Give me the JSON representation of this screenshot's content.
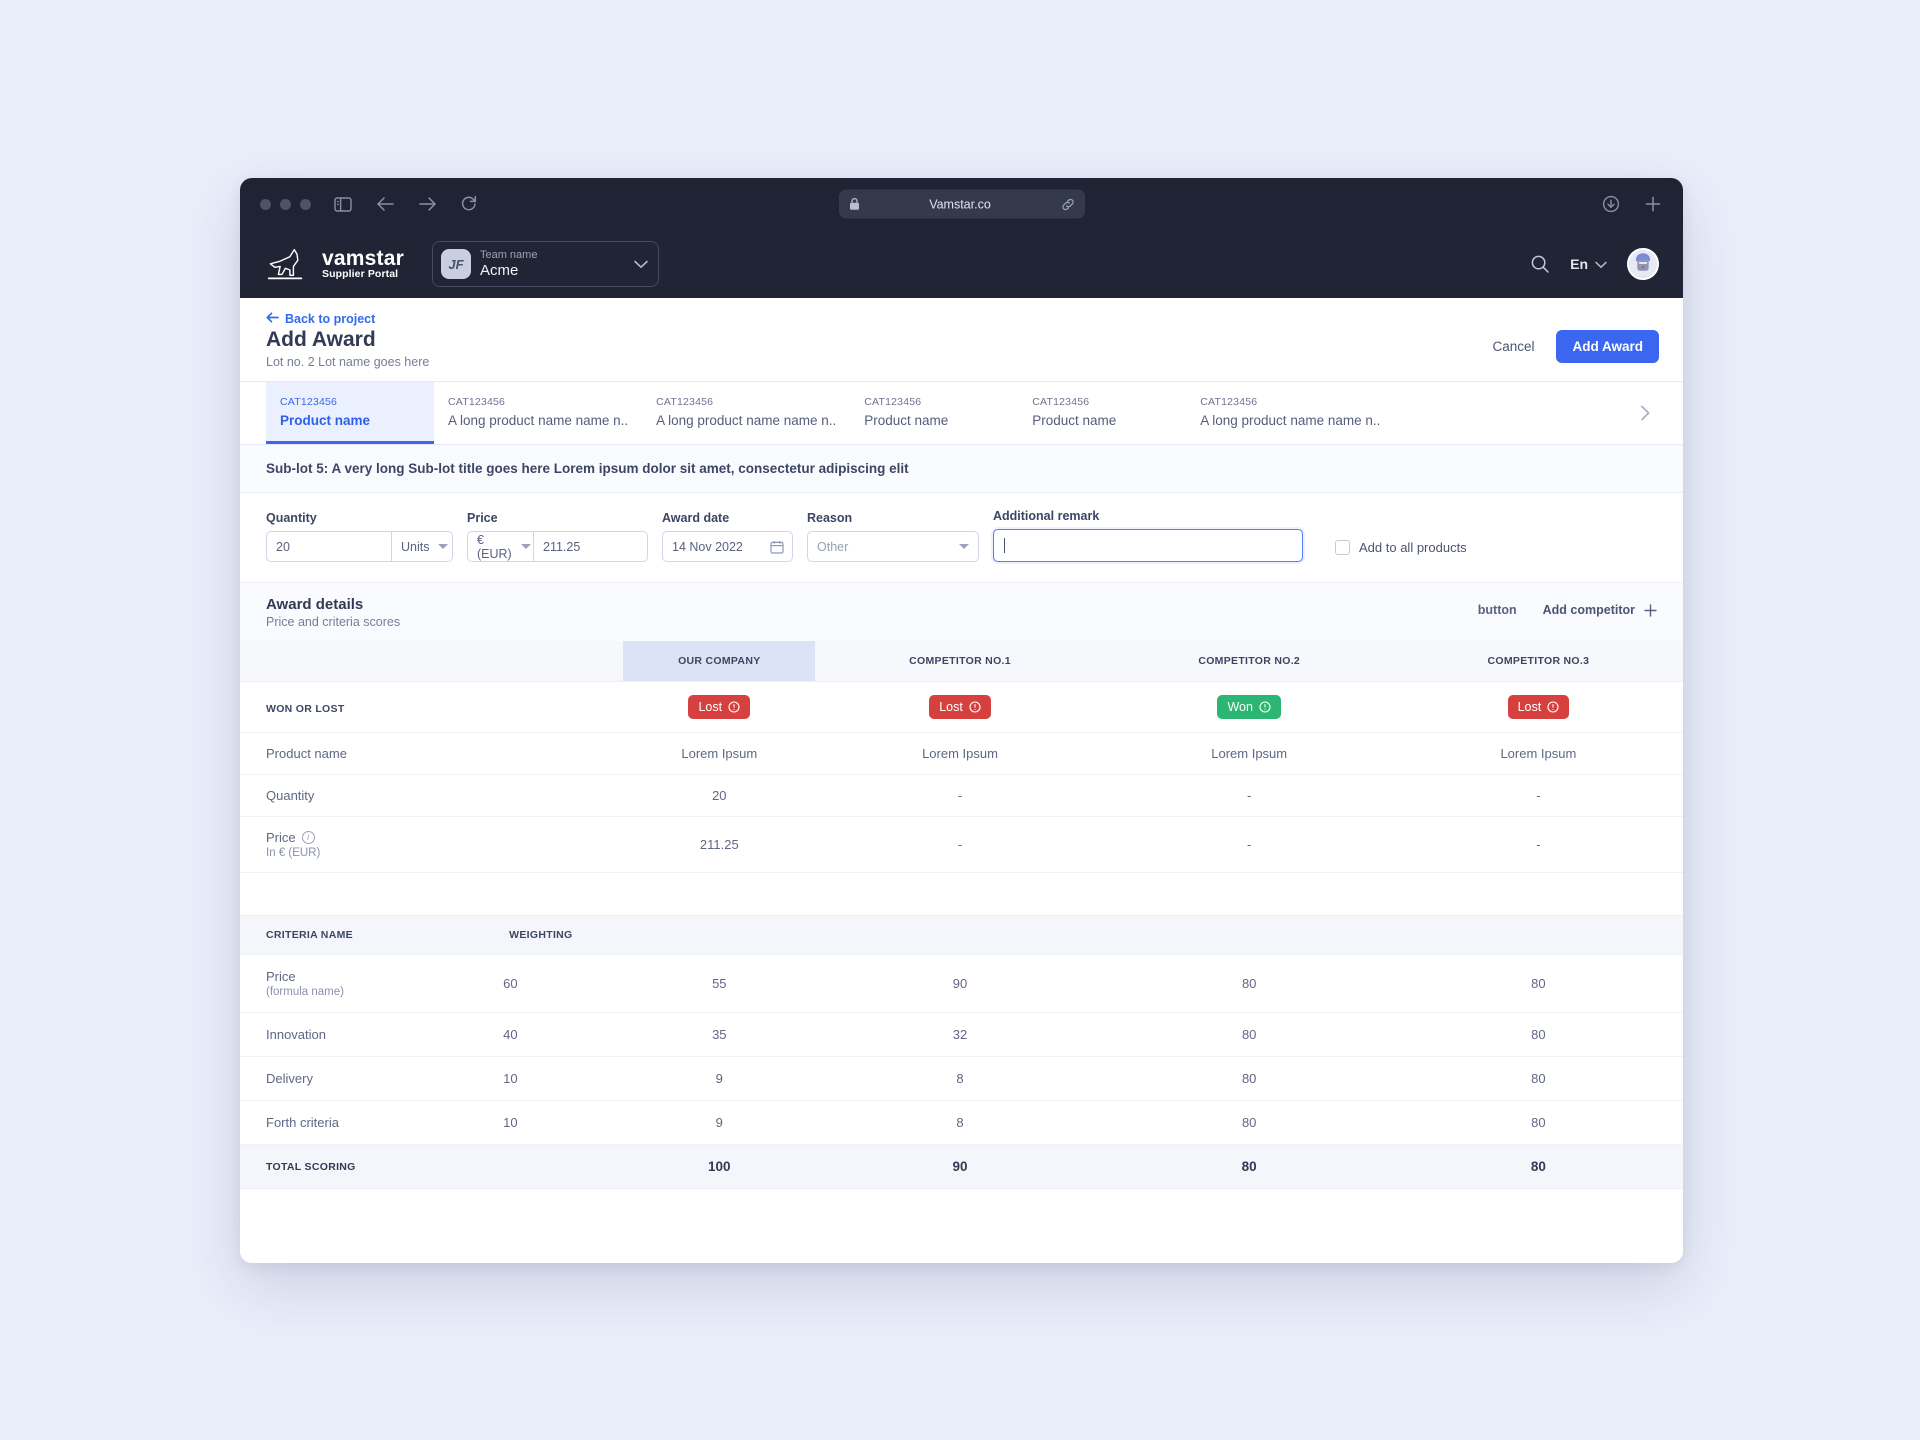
{
  "browser": {
    "url": "Vamstar.co",
    "lock_icon": "lock-icon",
    "link_icon": "link-icon",
    "back_icon": "back-arrow-icon",
    "forward_icon": "forward-arrow-icon",
    "reload_icon": "reload-icon",
    "sidebar_icon": "sidebar-toggle-icon",
    "download_icon": "download-icon",
    "newtab_icon": "new-tab-icon"
  },
  "appbar": {
    "logo_name": "vamstar",
    "logo_sub": "Supplier Portal",
    "team_label": "Team name",
    "team_value": "Acme",
    "team_initials": "JF",
    "search_icon": "search-icon",
    "language": "En",
    "avatar": "user-avatar"
  },
  "pagehead": {
    "back_label": "Back to project",
    "title": "Add Award",
    "subtitle": "Lot no. 2  Lot name goes here",
    "cancel_label": "Cancel",
    "primary_label": "Add Award"
  },
  "tabs": {
    "next_icon": "chevron-right-icon",
    "items": [
      {
        "cat": "CAT123456",
        "name": "Product name",
        "active": true
      },
      {
        "cat": "CAT123456",
        "name": "A long product name name n..",
        "active": false
      },
      {
        "cat": "CAT123456",
        "name": "A long product name name n..",
        "active": false
      },
      {
        "cat": "CAT123456",
        "name": "Product name",
        "active": false
      },
      {
        "cat": "CAT123456",
        "name": "Product name",
        "active": false
      },
      {
        "cat": "CAT123456",
        "name": "A long product name name n..",
        "active": false
      }
    ]
  },
  "sublot": {
    "title": "Sub-lot 5: A very long Sub-lot title goes here Lorem ipsum dolor sit amet, consectetur adipiscing elit"
  },
  "form": {
    "quantity_label": "Quantity",
    "quantity_value": "20",
    "quantity_unit": "Units",
    "price_label": "Price",
    "price_currency": "€ (EUR)",
    "price_value": "211.25",
    "date_label": "Award date",
    "date_value": "14 Nov 2022",
    "date_icon": "calendar-icon",
    "reason_label": "Reason",
    "reason_value": "Other",
    "remark_label": "Additional remark",
    "remark_value": "",
    "add_all_label": "Add to all products"
  },
  "award": {
    "title": "Award details",
    "subtitle": "Price and criteria scores",
    "button_label": "button",
    "add_competitor_label": "Add competitor",
    "add_icon": "plus-icon"
  },
  "comparison": {
    "columns": [
      "",
      "OUR COMPANY",
      "COMPETITOR NO.1",
      "COMPETITOR NO.2",
      "COMPETITOR NO.3"
    ],
    "rows": [
      {
        "label": "WON OR LOST",
        "label_strong": true,
        "type": "badge",
        "values": [
          {
            "text": "Lost",
            "state": "lost",
            "icon": "alert-circle-icon"
          },
          {
            "text": "Lost",
            "state": "lost",
            "icon": "alert-circle-icon"
          },
          {
            "text": "Won",
            "state": "won",
            "icon": "alert-circle-icon"
          },
          {
            "text": "Lost",
            "state": "lost",
            "icon": "alert-circle-icon"
          }
        ]
      },
      {
        "label": "Product name",
        "type": "text",
        "values": [
          "Lorem Ipsum",
          "Lorem Ipsum",
          "Lorem Ipsum",
          "Lorem Ipsum"
        ]
      },
      {
        "label": "Quantity",
        "type": "text",
        "values": [
          "20",
          "-",
          "-",
          "-"
        ]
      },
      {
        "label": "Price",
        "label_icon": "info-icon",
        "sublabel": "In € (EUR)",
        "type": "text",
        "values": [
          "211.25",
          "-",
          "-",
          "-"
        ]
      }
    ]
  },
  "criteria": {
    "columns": [
      "CRITERIA NAME",
      "WEIGHTING",
      "",
      "",
      "",
      ""
    ],
    "rows": [
      {
        "name": "Price",
        "note": "(formula name)",
        "weighting": "60",
        "scores": [
          "55",
          "90",
          "80",
          "80"
        ]
      },
      {
        "name": "Innovation",
        "note": "",
        "weighting": "40",
        "scores": [
          "35",
          "32",
          "80",
          "80"
        ]
      },
      {
        "name": "Delivery",
        "note": "",
        "weighting": "10",
        "scores": [
          "9",
          "8",
          "80",
          "80"
        ]
      },
      {
        "name": "Forth criteria",
        "note": "",
        "weighting": "10",
        "scores": [
          "9",
          "8",
          "80",
          "80"
        ]
      }
    ],
    "total": {
      "label": "TOTAL SCORING",
      "weighting": "",
      "scores": [
        "100",
        "90",
        "80",
        "80"
      ]
    }
  },
  "colors": {
    "accent": "#3a66f0",
    "lost": "#d6413f",
    "won": "#2bb673",
    "chrome": "#1f2333",
    "appbar": "#202434",
    "page_bg": "#eaeefb"
  }
}
